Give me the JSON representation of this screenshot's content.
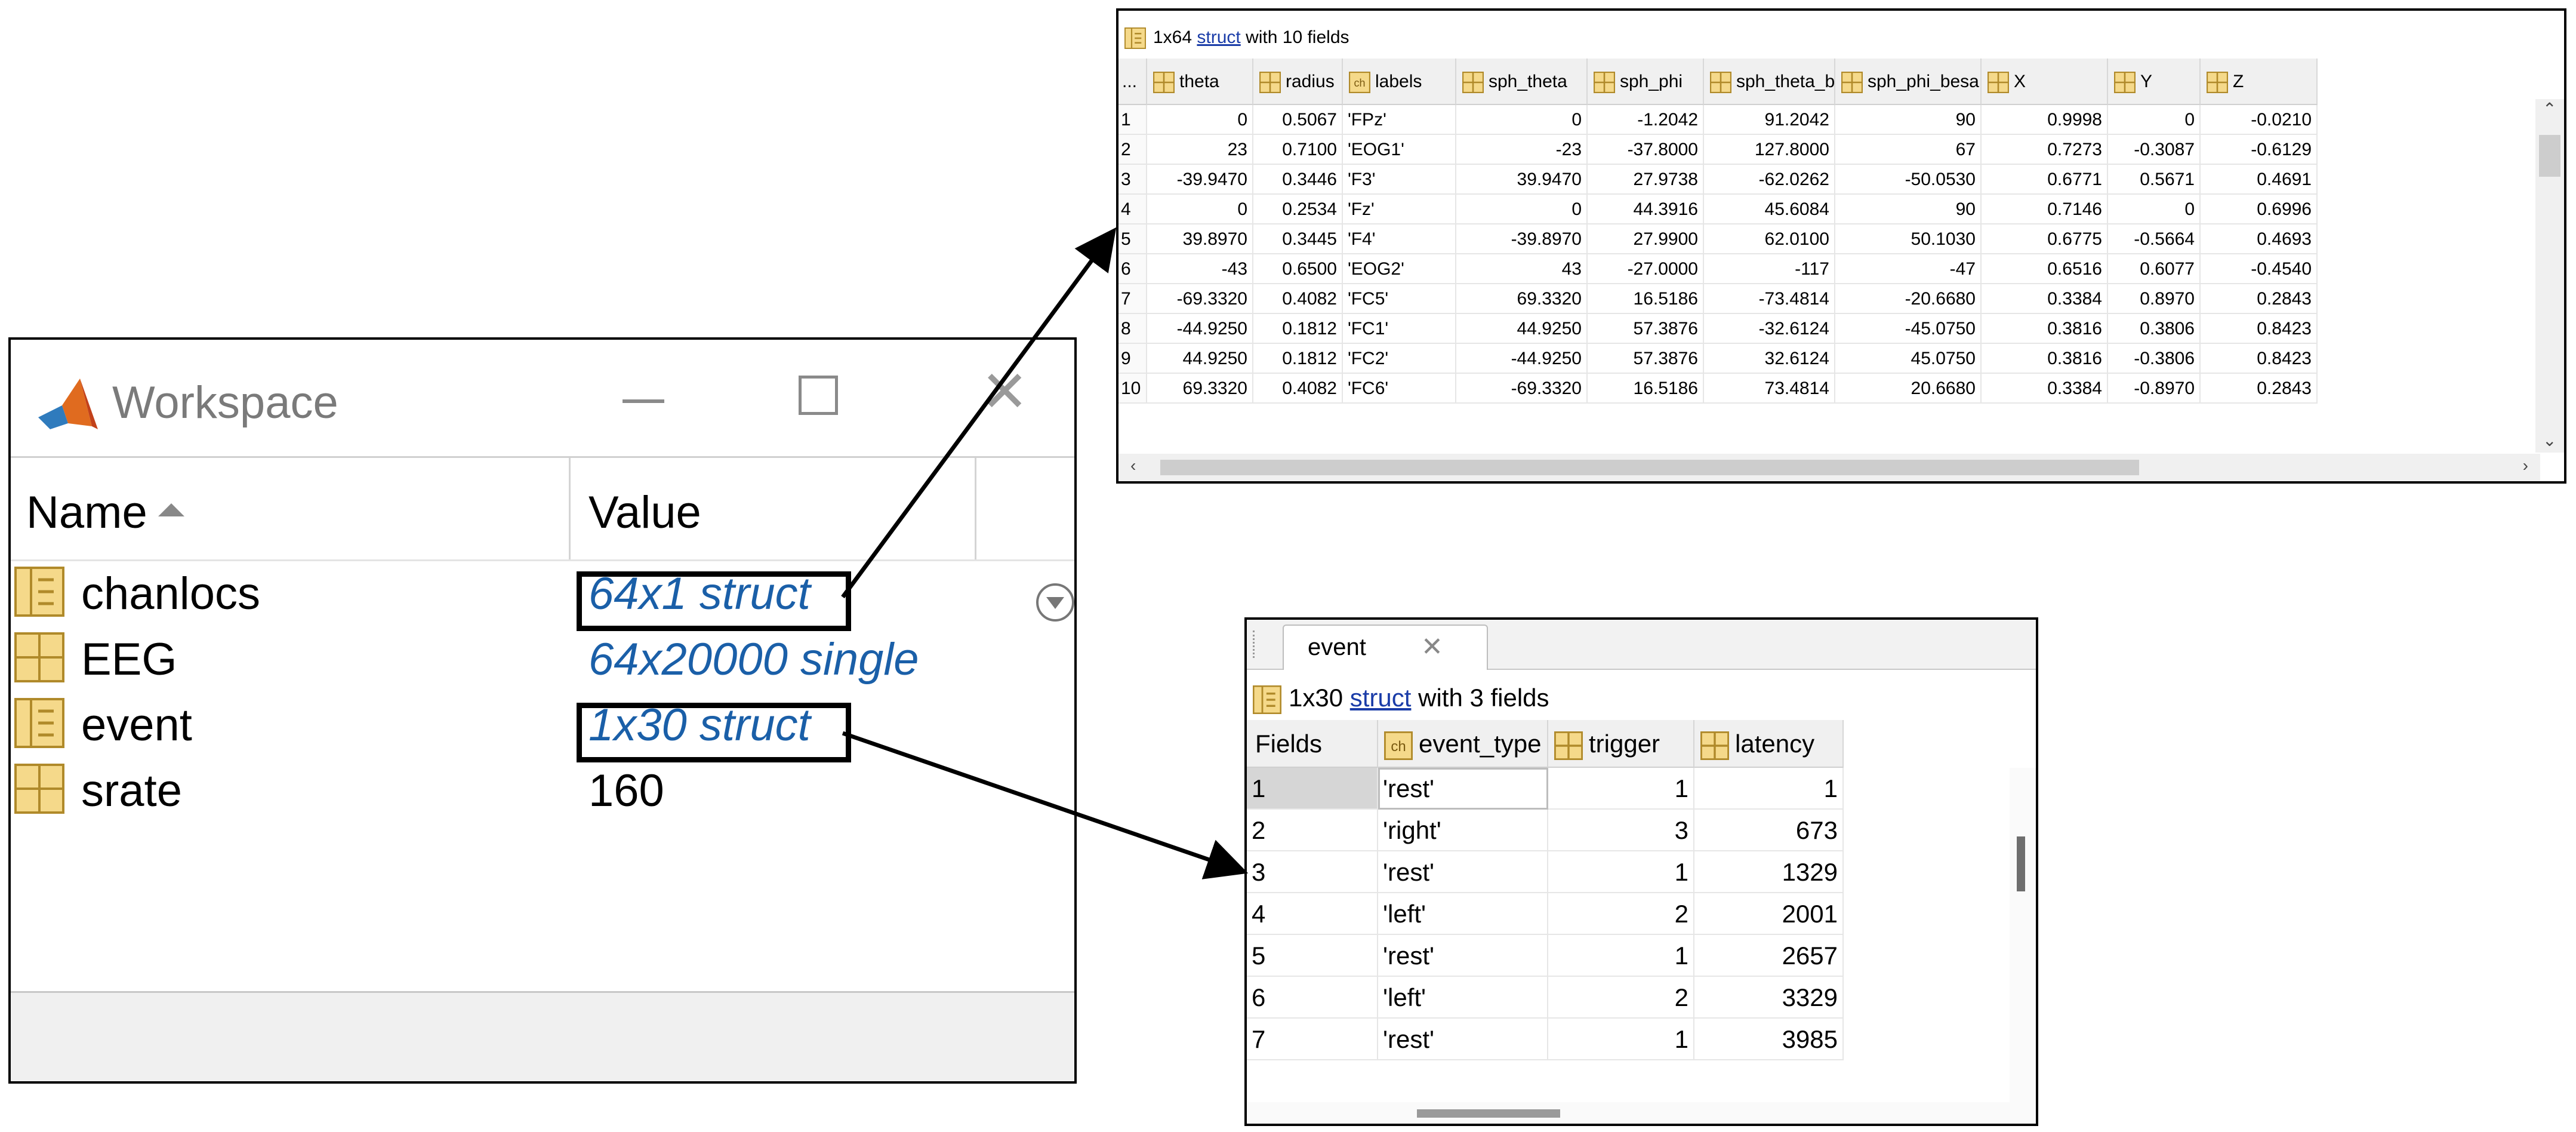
{
  "workspace": {
    "title": "Workspace",
    "minimize_label": "—",
    "close_label": "✕",
    "columns": {
      "name": "Name",
      "value": "Value"
    },
    "rows": [
      {
        "name": "chanlocs",
        "value": "64x1 struct",
        "icon": "struct-icon",
        "link": true
      },
      {
        "name": "EEG",
        "value": "64x20000 single",
        "icon": "matrix-icon",
        "link": true
      },
      {
        "name": "event",
        "value": "1x30 struct",
        "icon": "struct-icon",
        "link": true
      },
      {
        "name": "srate",
        "value": "160",
        "icon": "matrix-icon",
        "link": false
      }
    ]
  },
  "chanlocs_editor": {
    "caption_prefix": "1x64 ",
    "caption_link": "struct",
    "caption_suffix": " with 10 fields",
    "index_header": "...",
    "columns": [
      {
        "label": "theta",
        "icon": "matrix-icon"
      },
      {
        "label": "radius",
        "icon": "matrix-icon"
      },
      {
        "label": "labels",
        "icon": "char-icon"
      },
      {
        "label": "sph_theta",
        "icon": "matrix-icon"
      },
      {
        "label": "sph_phi",
        "icon": "matrix-icon"
      },
      {
        "label": "sph_theta_besa",
        "icon": "matrix-icon"
      },
      {
        "label": "sph_phi_besa",
        "icon": "matrix-icon"
      },
      {
        "label": "X",
        "icon": "matrix-icon"
      },
      {
        "label": "Y",
        "icon": "matrix-icon"
      },
      {
        "label": "Z",
        "icon": "matrix-icon"
      }
    ],
    "rows": [
      [
        "1",
        "0",
        "0.5067",
        "'FPz'",
        "0",
        "-1.2042",
        "91.2042",
        "90",
        "0.9998",
        "0",
        "-0.0210"
      ],
      [
        "2",
        "23",
        "0.7100",
        "'EOG1'",
        "-23",
        "-37.8000",
        "127.8000",
        "67",
        "0.7273",
        "-0.3087",
        "-0.6129"
      ],
      [
        "3",
        "-39.9470",
        "0.3446",
        "'F3'",
        "39.9470",
        "27.9738",
        "-62.0262",
        "-50.0530",
        "0.6771",
        "0.5671",
        "0.4691"
      ],
      [
        "4",
        "0",
        "0.2534",
        "'Fz'",
        "0",
        "44.3916",
        "45.6084",
        "90",
        "0.7146",
        "0",
        "0.6996"
      ],
      [
        "5",
        "39.8970",
        "0.3445",
        "'F4'",
        "-39.8970",
        "27.9900",
        "62.0100",
        "50.1030",
        "0.6775",
        "-0.5664",
        "0.4693"
      ],
      [
        "6",
        "-43",
        "0.6500",
        "'EOG2'",
        "43",
        "-27.0000",
        "-117",
        "-47",
        "0.6516",
        "0.6077",
        "-0.4540"
      ],
      [
        "7",
        "-69.3320",
        "0.4082",
        "'FC5'",
        "69.3320",
        "16.5186",
        "-73.4814",
        "-20.6680",
        "0.3384",
        "0.8970",
        "0.2843"
      ],
      [
        "8",
        "-44.9250",
        "0.1812",
        "'FC1'",
        "44.9250",
        "57.3876",
        "-32.6124",
        "-45.0750",
        "0.3816",
        "0.3806",
        "0.8423"
      ],
      [
        "9",
        "44.9250",
        "0.1812",
        "'FC2'",
        "-44.9250",
        "57.3876",
        "32.6124",
        "45.0750",
        "0.3816",
        "-0.3806",
        "0.8423"
      ],
      [
        "10",
        "69.3320",
        "0.4082",
        "'FC6'",
        "-69.3320",
        "16.5186",
        "73.4814",
        "20.6680",
        "0.3384",
        "-0.8970",
        "0.2843"
      ]
    ]
  },
  "event_editor": {
    "tab_label": "event",
    "tab_close": "✕",
    "caption_prefix": "1x30 ",
    "caption_link": "struct",
    "caption_suffix": " with 3 fields",
    "index_header": "Fields",
    "columns": [
      {
        "label": "event_type",
        "icon": "char-icon"
      },
      {
        "label": "trigger",
        "icon": "matrix-icon"
      },
      {
        "label": "latency",
        "icon": "matrix-icon"
      }
    ],
    "rows": [
      [
        "1",
        "'rest'",
        "1",
        "1"
      ],
      [
        "2",
        "'right'",
        "3",
        "673"
      ],
      [
        "3",
        "'rest'",
        "1",
        "1329"
      ],
      [
        "4",
        "'left'",
        "2",
        "2001"
      ],
      [
        "5",
        "'rest'",
        "1",
        "2657"
      ],
      [
        "6",
        "'left'",
        "2",
        "3329"
      ],
      [
        "7",
        "'rest'",
        "1",
        "3985"
      ]
    ]
  },
  "colors": {
    "link": "#1a5fa8",
    "icon_fill": "#f5d98a",
    "icon_border": "#b08a2a"
  }
}
